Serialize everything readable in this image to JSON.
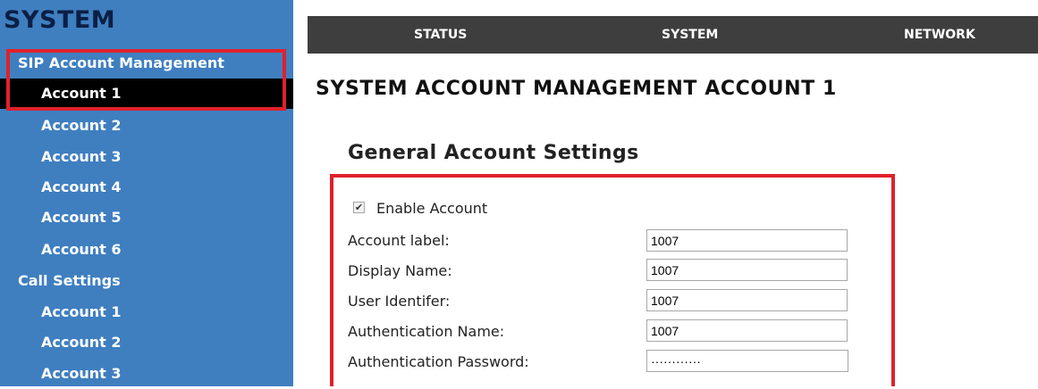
{
  "sidebar": {
    "title": "SYSTEM",
    "items": [
      {
        "label": "SIP Account Management"
      },
      {
        "label": "Account 1"
      },
      {
        "label": "Account 2"
      },
      {
        "label": "Account 3"
      },
      {
        "label": "Account 4"
      },
      {
        "label": "Account 5"
      },
      {
        "label": "Account 6"
      },
      {
        "label": "Call Settings"
      },
      {
        "label": "Account 1"
      },
      {
        "label": "Account 2"
      },
      {
        "label": "Account 3"
      }
    ]
  },
  "topnav": {
    "tabs": [
      {
        "label": "STATUS"
      },
      {
        "label": "SYSTEM"
      },
      {
        "label": "NETWORK"
      }
    ]
  },
  "main": {
    "page_title": "SYSTEM ACCOUNT MANAGEMENT ACCOUNT 1",
    "section_title": "General Account Settings",
    "enable_account": {
      "label": "Enable Account",
      "checked": true
    },
    "fields": [
      {
        "label": "Account label:",
        "value": "1007"
      },
      {
        "label": "Display Name:",
        "value": "1007"
      },
      {
        "label": "User Identifer:",
        "value": "1007"
      },
      {
        "label": "Authentication Name:",
        "value": "1007"
      },
      {
        "label": "Authentication Password:",
        "value": "············"
      }
    ]
  },
  "colors": {
    "sidebar_bg": "#3f7fc0",
    "topbar_bg": "#3e3e3e",
    "highlight": "#e0212b",
    "selected_bg": "#000000"
  }
}
